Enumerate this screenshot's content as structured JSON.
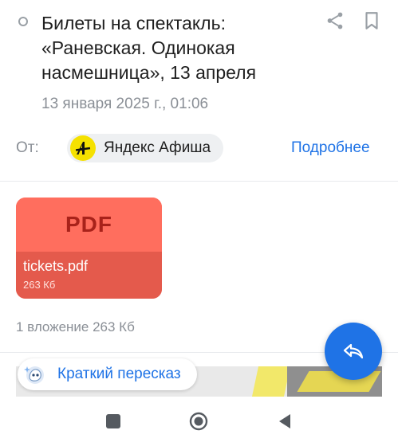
{
  "email": {
    "subject": "Билеты на спектакль: «Раневская. Одинокая насмешница», 13 апреля",
    "date": "13 января 2025 г., 01:06",
    "from_label": "От:",
    "sender_name": "Яндекс Афиша",
    "sender_logo_glyph": "А",
    "more_link": "Подробнее"
  },
  "attachment": {
    "badge": "PDF",
    "file_name": "tickets.pdf",
    "file_size": "263  Кб",
    "summary": "1 вложение 263  Кб"
  },
  "summary_chip": {
    "label": "Краткий пересказ"
  },
  "icons": {
    "share": "share-icon",
    "bookmark": "bookmark-icon",
    "reply": "reply-icon",
    "summary": "ai-summary-icon",
    "nav_recents": "recents-icon",
    "nav_home": "home-icon",
    "nav_back": "back-icon"
  },
  "colors": {
    "accent": "#1f73e6",
    "pdf_card": "#ff6e5e",
    "pdf_card_bottom": "#e45a4c",
    "muted_text": "#8a8f96",
    "sender_logo": "#f5e100"
  }
}
